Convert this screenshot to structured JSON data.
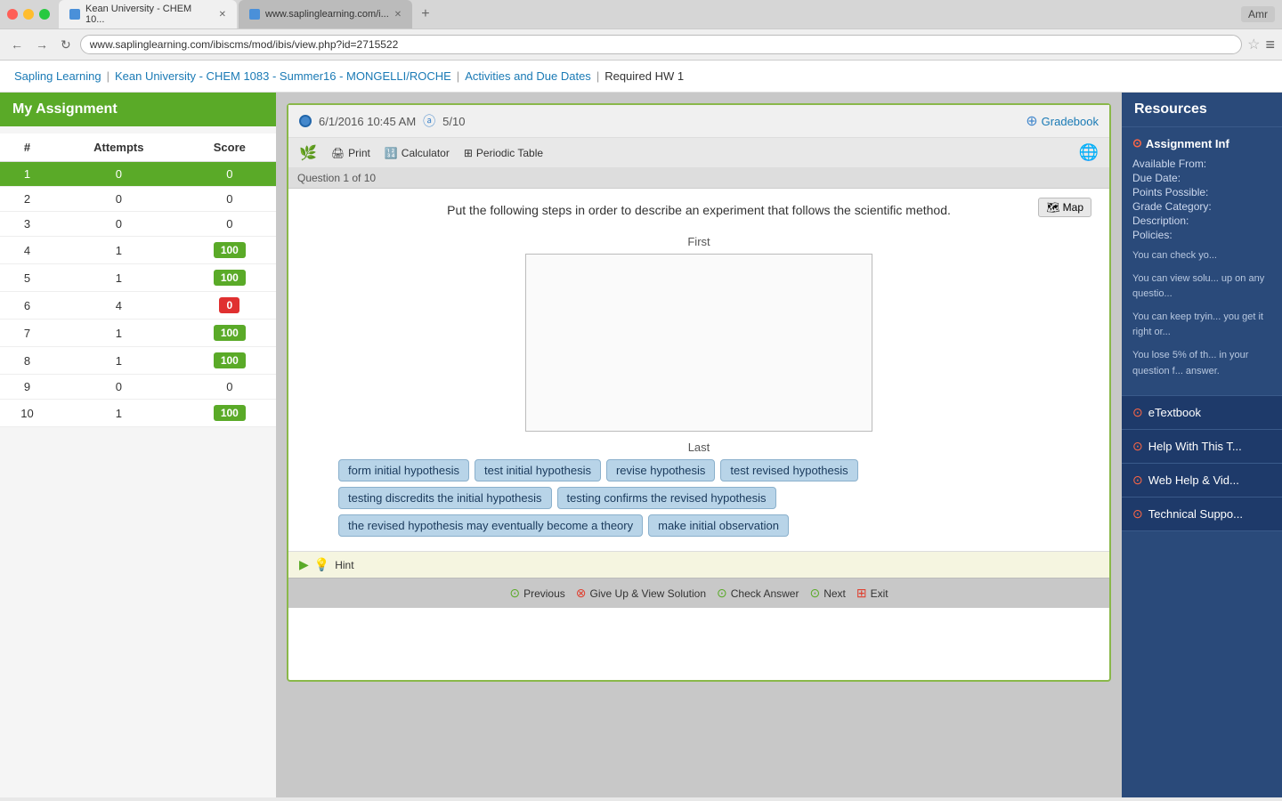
{
  "browser": {
    "tabs": [
      {
        "label": "Kean University - CHEM 10...",
        "active": true,
        "url": "www.saplinglearning.com/ibiscms/mod/ibis/view.php?id=2715522"
      },
      {
        "label": "www.saplinglearning.com/i...",
        "active": false
      }
    ],
    "address": "www.saplinglearning.com/ibiscms/mod/ibis/view.php?id=2715522",
    "user": "Amr"
  },
  "breadcrumb": {
    "items": [
      {
        "label": "Sapling Learning",
        "link": true
      },
      {
        "label": "Kean University - CHEM 1083 - Summer16 - MONGELLI/ROCHE",
        "link": true
      },
      {
        "label": "Activities and Due Dates",
        "link": true
      },
      {
        "label": "Required HW 1",
        "link": false
      }
    ]
  },
  "sidebar": {
    "title": "My Assignment",
    "table": {
      "headers": [
        "#",
        "Attempts",
        "Score"
      ],
      "rows": [
        {
          "num": 1,
          "attempts": 0,
          "score": "0",
          "selected": true,
          "score_type": "zero"
        },
        {
          "num": 2,
          "attempts": 0,
          "score": "0",
          "selected": false,
          "score_type": "zero"
        },
        {
          "num": 3,
          "attempts": 0,
          "score": "0",
          "selected": false,
          "score_type": "zero"
        },
        {
          "num": 4,
          "attempts": 1,
          "score": "100",
          "selected": false,
          "score_type": "green"
        },
        {
          "num": 5,
          "attempts": 1,
          "score": "100",
          "selected": false,
          "score_type": "green"
        },
        {
          "num": 6,
          "attempts": 4,
          "score": "0",
          "selected": false,
          "score_type": "red"
        },
        {
          "num": 7,
          "attempts": 1,
          "score": "100",
          "selected": false,
          "score_type": "green"
        },
        {
          "num": 8,
          "attempts": 1,
          "score": "100",
          "selected": false,
          "score_type": "green"
        },
        {
          "num": 9,
          "attempts": 0,
          "score": "0",
          "selected": false,
          "score_type": "zero"
        },
        {
          "num": 10,
          "attempts": 1,
          "score": "100",
          "selected": false,
          "score_type": "green"
        }
      ]
    }
  },
  "question": {
    "date": "6/1/2016 10:45 AM",
    "score_display": "5/10",
    "gradebook_label": "Gradebook",
    "toolbar": {
      "print": "Print",
      "calculator": "Calculator",
      "periodic_table": "Periodic Table"
    },
    "question_number": "Question 1 of 10",
    "map_button": "Map",
    "body_text": "Put the following steps in order to describe an experiment that follows the scientific method.",
    "first_label": "First",
    "last_label": "Last",
    "drag_items": [
      "form initial hypothesis",
      "test initial hypothesis",
      "revise hypothesis",
      "test revised hypothesis",
      "testing discredits the initial hypothesis",
      "testing confirms the revised hypothesis",
      "the revised hypothesis may eventually become a theory",
      "make initial observation"
    ],
    "bottom_buttons": {
      "hint": "Hint",
      "previous": "Previous",
      "give_up": "Give Up & View Solution",
      "check_answer": "Check Answer",
      "next": "Next",
      "exit": "Exit"
    }
  },
  "resources": {
    "title": "Resources",
    "assignment_info_label": "Assignment Inf",
    "fields": {
      "available_from": "Available From:",
      "due_date": "Due Date:",
      "points_possible": "Points Possible:",
      "grade_category": "Grade Category:",
      "description": "Description:",
      "policies": "Policies:"
    },
    "policy_texts": [
      "You can check yo...",
      "You can view solu... up on any questio...",
      "You can keep tryin... you get it right or...",
      "You lose 5% of th... in your question f... answer."
    ],
    "links": [
      {
        "label": "eTextbook",
        "icon": "circle-icon"
      },
      {
        "label": "Help With This T...",
        "icon": "circle-icon"
      },
      {
        "label": "Web Help & Vid...",
        "icon": "circle-icon"
      },
      {
        "label": "Technical Suppo...",
        "icon": "circle-icon"
      }
    ]
  }
}
